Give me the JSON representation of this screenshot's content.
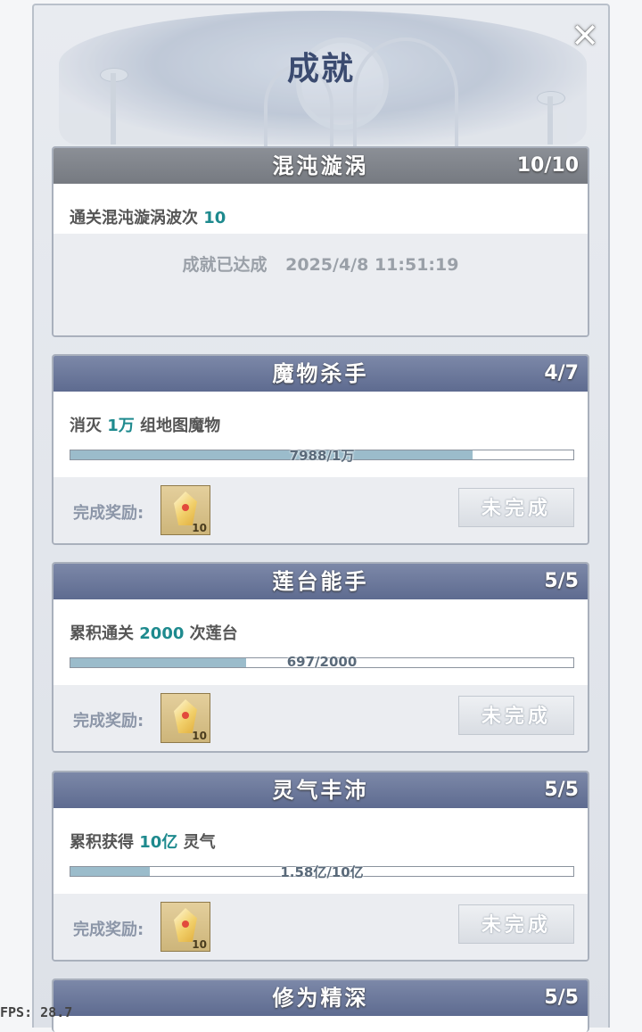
{
  "window": {
    "title": "成就"
  },
  "close_icon": "close-icon",
  "cards": [
    {
      "name": "混沌漩涡",
      "count": "10/10",
      "status": "done",
      "desc_prefix": "通关混沌漩涡波次",
      "desc_value": "10",
      "desc_suffix": "",
      "completed_label": "成就已达成",
      "completed_time": "2025/4/8 11:51:19"
    },
    {
      "name": "魔物杀手",
      "count": "4/7",
      "status": "progress",
      "desc_prefix": "消灭",
      "desc_value": "1万",
      "desc_suffix": "组地图魔物",
      "progress_text": "7988/1万",
      "progress_fraction": 0.7988,
      "reward_label": "完成奖励:",
      "reward_icon": "crystal-icon",
      "reward_qty": "10",
      "button_label": "未完成"
    },
    {
      "name": "莲台能手",
      "count": "5/5",
      "status": "progress",
      "desc_prefix": "累积通关",
      "desc_value": "2000",
      "desc_suffix": "次莲台",
      "progress_text": "697/2000",
      "progress_fraction": 0.3485,
      "reward_label": "完成奖励:",
      "reward_icon": "crystal-icon",
      "reward_qty": "10",
      "button_label": "未完成"
    },
    {
      "name": "灵气丰沛",
      "count": "5/5",
      "status": "progress",
      "desc_prefix": "累积获得",
      "desc_value": "10亿",
      "desc_suffix": "灵气",
      "progress_text": "1.58亿/10亿",
      "progress_fraction": 0.158,
      "reward_label": "完成奖励:",
      "reward_icon": "crystal-icon",
      "reward_qty": "10",
      "button_label": "未完成"
    },
    {
      "name": "修为精深",
      "count": "5/5"
    }
  ],
  "fps": "FPS: 28.7"
}
